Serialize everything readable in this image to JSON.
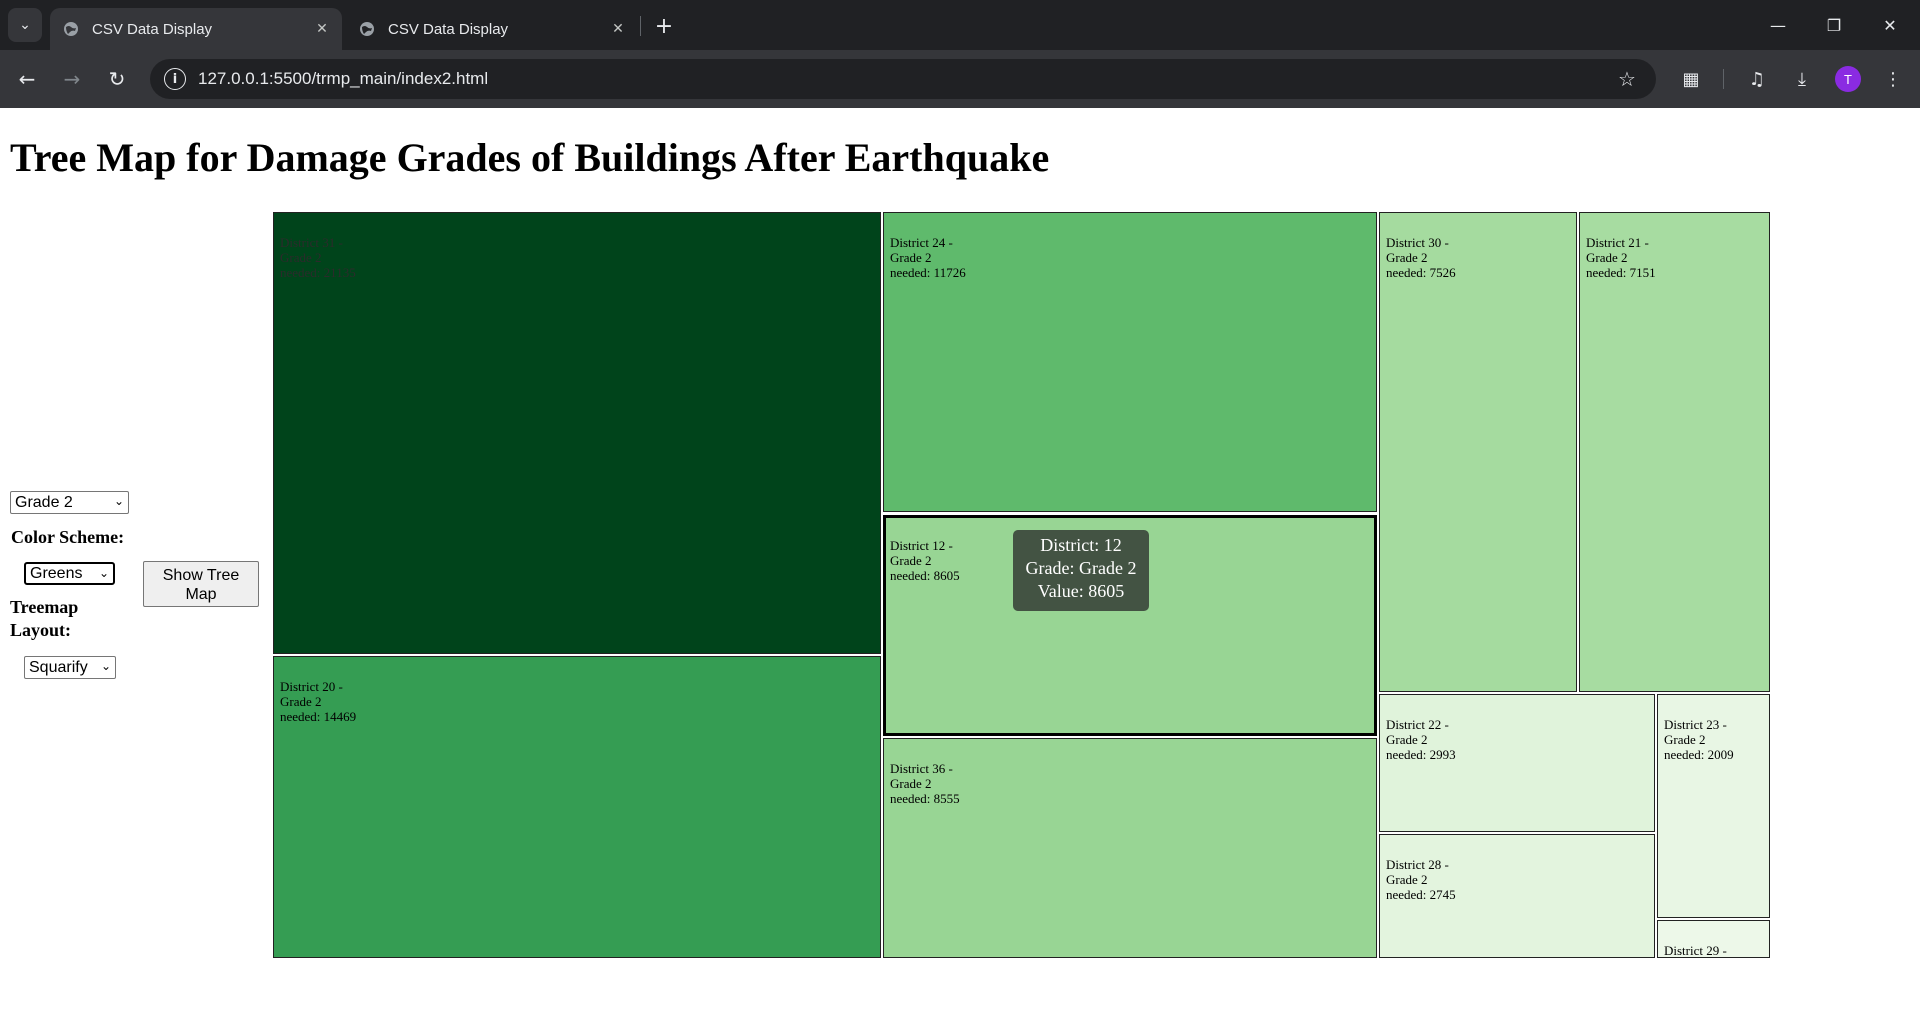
{
  "browser": {
    "tabs": [
      {
        "title": "CSV Data Display",
        "active": true
      },
      {
        "title": "CSV Data Display",
        "active": false
      }
    ],
    "url": "127.0.0.1:5500/trmp_main/index2.html",
    "profile_initial": "T"
  },
  "page": {
    "title": "Tree Map for Damage Grades of Buildings After Earthquake"
  },
  "controls": {
    "grade_select_value": "Grade 2",
    "color_scheme_label": "Color Scheme:",
    "color_scheme_value": "Greens",
    "layout_label_line1": "Treemap",
    "layout_label_line2": "Layout:",
    "layout_value": "Squarify",
    "show_button_line1": "Show Tree",
    "show_button_line2": "Map"
  },
  "tooltip": {
    "district": "District: 12",
    "grade": "Grade: Grade 2",
    "value": "Value: 8605"
  },
  "chart_data": {
    "type": "treemap",
    "title": "Tree Map for Damage Grades of Buildings After Earthquake",
    "color_scheme": "Greens",
    "series": [
      {
        "district": "District 31",
        "grade": "Grade 2",
        "value": 21135,
        "line1": "District 31 -",
        "line2": "Grade 2",
        "line3": "needed: 21135",
        "color": "#00441b"
      },
      {
        "district": "District 20",
        "grade": "Grade 2",
        "value": 14469,
        "line1": "District 20 -",
        "line2": "Grade 2",
        "line3": "needed: 14469",
        "color": "#359d53"
      },
      {
        "district": "District 24",
        "grade": "Grade 2",
        "value": 11726,
        "line1": "District 24 -",
        "line2": "Grade 2",
        "line3": "needed: 11726",
        "color": "#5fba6c"
      },
      {
        "district": "District 12",
        "grade": "Grade 2",
        "value": 8605,
        "line1": "District 12 -",
        "line2": "Grade 2",
        "line3": "needed: 8605",
        "color": "#98d594",
        "selected": true
      },
      {
        "district": "District 36",
        "grade": "Grade 2",
        "value": 8555,
        "line1": "District 36 -",
        "line2": "Grade 2",
        "line3": "needed: 8555",
        "color": "#98d594"
      },
      {
        "district": "District 30",
        "grade": "Grade 2",
        "value": 7526,
        "line1": "District 30 -",
        "line2": "Grade 2",
        "line3": "needed: 7526",
        "color": "#a5db9f"
      },
      {
        "district": "District 21",
        "grade": "Grade 2",
        "value": 7151,
        "line1": "District 21 -",
        "line2": "Grade 2",
        "line3": "needed: 7151",
        "color": "#a7dca1"
      },
      {
        "district": "District 22",
        "grade": "Grade 2",
        "value": 2993,
        "line1": "District 22 -",
        "line2": "Grade 2",
        "line3": "needed: 2993",
        "color": "#e0f3db"
      },
      {
        "district": "District 28",
        "grade": "Grade 2",
        "value": 2745,
        "line1": "District 28 -",
        "line2": "Grade 2",
        "line3": "needed: 2745",
        "color": "#e3f4de"
      },
      {
        "district": "District 23",
        "grade": "Grade 2",
        "value": 2009,
        "line1": "District 23 -",
        "line2": "Grade 2",
        "line3": "needed: 2009",
        "color": "#e8f6e4"
      },
      {
        "district": "District 29",
        "grade": "Grade 2",
        "line1": "District 29 -",
        "line2": "",
        "line3": "",
        "color": "#edf8e9"
      }
    ]
  }
}
